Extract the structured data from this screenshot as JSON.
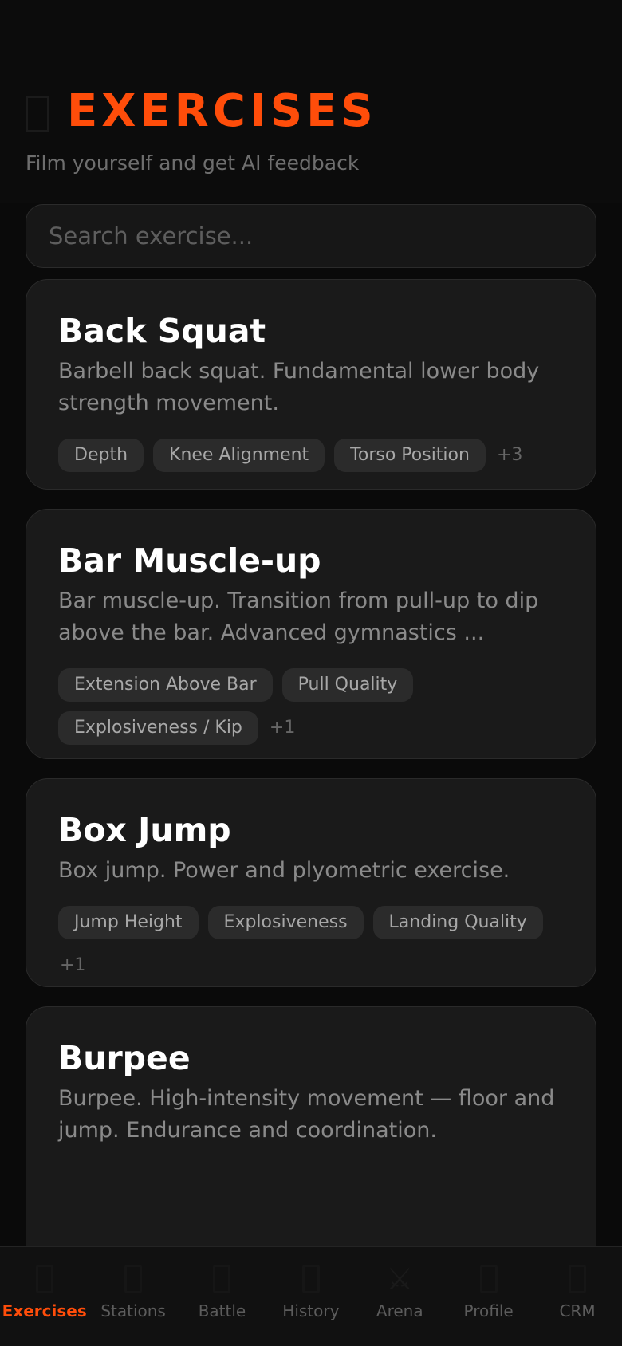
{
  "header": {
    "title_icon": "document-icon",
    "title": "EXERCISES",
    "subtitle": "Film yourself and get AI feedback"
  },
  "search": {
    "placeholder": "Search exercise..."
  },
  "exercises": [
    {
      "title": "Back Squat",
      "description": "Barbell back squat. Fundamental lower body strength movement.",
      "tags": [
        "Depth",
        "Knee Alignment",
        "Torso Position"
      ],
      "more": "+3"
    },
    {
      "title": "Bar Muscle-up",
      "description": "Bar muscle-up. Transition from pull-up to dip above the bar. Advanced gymnastics ...",
      "tags": [
        "Extension Above Bar",
        "Pull Quality",
        "Explosiveness / Kip"
      ],
      "more": "+1"
    },
    {
      "title": "Box Jump",
      "description": "Box jump. Power and plyometric exercise.",
      "tags": [
        "Jump Height",
        "Explosiveness",
        "Landing Quality"
      ],
      "more": "+1"
    },
    {
      "title": "Burpee",
      "description": "Burpee. High-intensity movement — floor and jump. Endurance and coordination.",
      "tags": [],
      "more": ""
    }
  ],
  "nav": {
    "items": [
      {
        "label": "Exercises",
        "icon": "exercises-icon",
        "active": true
      },
      {
        "label": "Stations",
        "icon": "stations-icon",
        "active": false
      },
      {
        "label": "Battle",
        "icon": "battle-icon",
        "active": false
      },
      {
        "label": "History",
        "icon": "history-icon",
        "active": false
      },
      {
        "label": "Arena",
        "icon": "swords-icon",
        "active": false
      },
      {
        "label": "Profile",
        "icon": "profile-icon",
        "active": false
      },
      {
        "label": "CRM",
        "icon": "crm-icon",
        "active": false
      }
    ]
  },
  "colors": {
    "accent": "#ff4d0a",
    "background": "#0a0a0a",
    "card": "#1a1a1a"
  }
}
